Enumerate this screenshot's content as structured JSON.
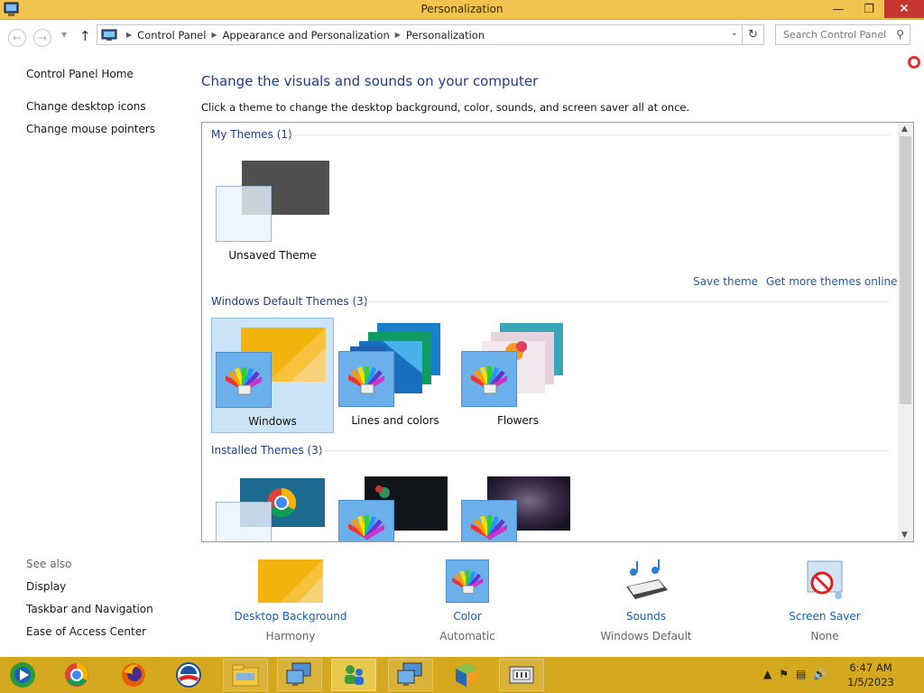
{
  "window": {
    "title": "Personalization"
  },
  "address": {
    "breadcrumbs": [
      "Control Panel",
      "Appearance and Personalization",
      "Personalization"
    ],
    "search_placeholder": "Search Control Panel"
  },
  "left_pane": {
    "links": [
      "Control Panel Home",
      "Change desktop icons",
      "Change mouse pointers"
    ],
    "see_also_label": "See also",
    "see_also": [
      "Display",
      "Taskbar and Navigation",
      "Ease of Access Center"
    ]
  },
  "main": {
    "heading": "Change the visuals and sounds on your computer",
    "subheading": "Click a theme to change the desktop background, color, sounds, and screen saver all at once.",
    "groups": [
      {
        "label": "My Themes (1)",
        "themes": [
          {
            "name": "Unsaved Theme"
          }
        ]
      },
      {
        "label": "Windows Default Themes (3)",
        "themes": [
          {
            "name": "Windows",
            "selected": true
          },
          {
            "name": "Lines and colors"
          },
          {
            "name": "Flowers"
          }
        ]
      },
      {
        "label": "Installed Themes (3)",
        "themes": []
      }
    ],
    "save_theme": "Save theme",
    "get_more": "Get more themes online"
  },
  "settings": [
    {
      "label": "Desktop Background",
      "value": "Harmony"
    },
    {
      "label": "Color",
      "value": "Automatic"
    },
    {
      "label": "Sounds",
      "value": "Windows Default"
    },
    {
      "label": "Screen Saver",
      "value": "None"
    }
  ],
  "taskbar": {
    "time": "6:47 AM",
    "date": "1/5/2023"
  },
  "colors": {
    "title_bar": "#f0c44e",
    "taskbar": "#d4a81f",
    "link": "#1e5ea8",
    "heading": "#1e3a8c",
    "selection": "#cce4f7"
  }
}
